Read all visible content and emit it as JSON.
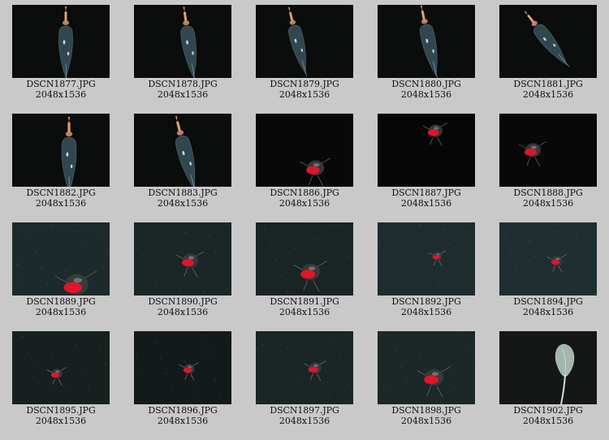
{
  "gallery": {
    "thumbnails": [
      {
        "filename": "DSCN1877.JPG",
        "dimensions": "2048x1536",
        "subject": "siphonophore",
        "background": "#0b0c0c"
      },
      {
        "filename": "DSCN1878.JPG",
        "dimensions": "2048x1536",
        "subject": "siphonophore",
        "background": "#0b0c0c"
      },
      {
        "filename": "DSCN1879.JPG",
        "dimensions": "2048x1536",
        "subject": "siphonophore",
        "background": "#0b0c0c"
      },
      {
        "filename": "DSCN1880.JPG",
        "dimensions": "2048x1536",
        "subject": "siphonophore",
        "background": "#0b0c0c"
      },
      {
        "filename": "DSCN1881.JPG",
        "dimensions": "2048x1536",
        "subject": "siphonophore",
        "background": "#0b0c0c"
      },
      {
        "filename": "DSCN1882.JPG",
        "dimensions": "2048x1536",
        "subject": "siphonophore",
        "background": "#0b0c0c"
      },
      {
        "filename": "DSCN1883.JPG",
        "dimensions": "2048x1536",
        "subject": "siphonophore",
        "background": "#0b0c0c"
      },
      {
        "filename": "DSCN1886.JPG",
        "dimensions": "2048x1536",
        "subject": "red-jellyfish",
        "background": "#080808"
      },
      {
        "filename": "DSCN1887.JPG",
        "dimensions": "2048x1536",
        "subject": "red-jellyfish",
        "background": "#060606"
      },
      {
        "filename": "DSCN1888.JPG",
        "dimensions": "2048x1536",
        "subject": "red-jellyfish",
        "background": "#080808"
      },
      {
        "filename": "DSCN1889.JPG",
        "dimensions": "2048x1536",
        "subject": "red-jellyfish",
        "background": "#1c2a2b"
      },
      {
        "filename": "DSCN1890.JPG",
        "dimensions": "2048x1536",
        "subject": "red-jellyfish",
        "background": "#1b2627"
      },
      {
        "filename": "DSCN1891.JPG",
        "dimensions": "2048x1536",
        "subject": "red-jellyfish",
        "background": "#1a2425"
      },
      {
        "filename": "DSCN1892.JPG",
        "dimensions": "2048x1536",
        "subject": "red-jellyfish",
        "background": "#1e2c2e"
      },
      {
        "filename": "DSCN1894.JPG",
        "dimensions": "2048x1536",
        "subject": "red-jellyfish",
        "background": "#1f2e31"
      },
      {
        "filename": "DSCN1895.JPG",
        "dimensions": "2048x1536",
        "subject": "red-jellyfish",
        "background": "#17201f"
      },
      {
        "filename": "DSCN1896.JPG",
        "dimensions": "2048x1536",
        "subject": "red-jellyfish",
        "background": "#141a1a"
      },
      {
        "filename": "DSCN1897.JPG",
        "dimensions": "2048x1536",
        "subject": "red-jellyfish",
        "background": "#1a2525"
      },
      {
        "filename": "DSCN1898.JPG",
        "dimensions": "2048x1536",
        "subject": "red-jellyfish",
        "background": "#1c2727"
      },
      {
        "filename": "DSCN1902.JPG",
        "dimensions": "2048x1536",
        "subject": "pale-leaf-organism",
        "background": "#151716"
      }
    ]
  },
  "colors": {
    "page_background": "#c9c9c9",
    "caption_text": "#111111",
    "jellyfish_red": "#e0142a",
    "siphonophore_tip": "#e0a26a"
  }
}
